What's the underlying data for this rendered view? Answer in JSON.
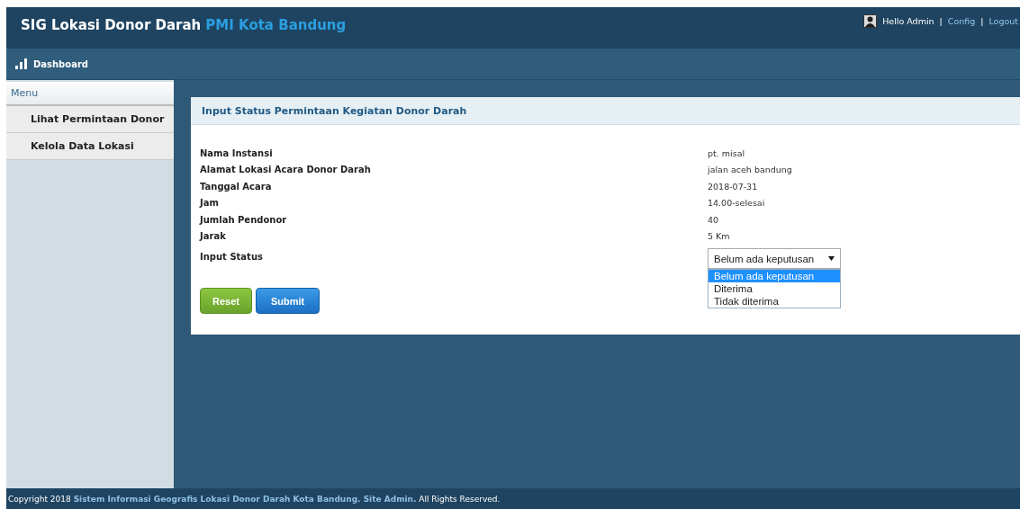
{
  "header": {
    "title": "SIG Lokasi Donor Darah",
    "title_highlight": "PMI Kota Bandung",
    "greeting": "Hello Admin",
    "separator": "|",
    "links": [
      "Config",
      "Logout"
    ]
  },
  "navbar": {
    "label": "Dashboard"
  },
  "sidebar": {
    "heading": "Menu",
    "items": [
      {
        "label": "Lihat Permintaan Donor"
      },
      {
        "label": "Kelola Data Lokasi"
      }
    ]
  },
  "card": {
    "title": "Input Status Permintaan Kegiatan Donor Darah",
    "fields": [
      {
        "label": "Nama Instansi",
        "value": "pt. misal"
      },
      {
        "label": "Alamat Lokasi Acara Donor Darah",
        "value": "jalan aceh bandung"
      },
      {
        "label": "Tanggal Acara",
        "value": "2018-07-31"
      },
      {
        "label": "Jam",
        "value": "14.00-selesai"
      },
      {
        "label": "Jumlah Pendonor",
        "value": "40"
      },
      {
        "label": "Jarak",
        "value": "5 Km"
      }
    ],
    "status": {
      "label": "Input Status",
      "value": "Belum ada keputusan",
      "expanded": true,
      "options": [
        {
          "label": "Belum ada keputusan",
          "selected": true
        },
        {
          "label": "Diterima",
          "selected": false
        },
        {
          "label": "Tidak diterima",
          "selected": false
        }
      ]
    },
    "buttons": [
      {
        "label": "Reset",
        "kind": "reset"
      },
      {
        "label": "Submit",
        "kind": "submit"
      }
    ]
  },
  "footer": {
    "prefix": "Copyright 2018",
    "link": "Sistem Informasi Geografis Lokasi Donor Darah Kota Bandung. Site Admin.",
    "suffix": "All Rights Reserved."
  }
}
